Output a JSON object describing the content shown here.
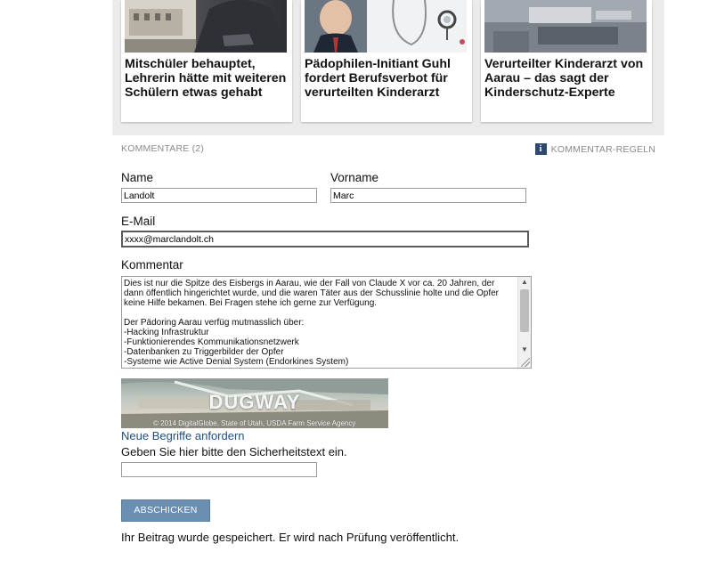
{
  "related_articles": [
    {
      "title": "Mitschüler behauptet, Lehrerin hätte mit weiteren Schülern etwas gehabt"
    },
    {
      "title": "Pädophilen-Initiant Guhl fordert Berufsverbot für verurteilten Kinderarzt"
    },
    {
      "title": "Verurteilter Kinderarzt von Aarau – das sagt der Kinderschutz-Experte"
    }
  ],
  "comments": {
    "count_label": "KOMMENTARE (2)",
    "rules_label": "KOMMENTAR-REGELN"
  },
  "form": {
    "name_label": "Name",
    "name_value": "Landolt",
    "vorname_label": "Vorname",
    "vorname_value": "Marc",
    "email_label": "E-Mail",
    "email_value": "xxxx@marclandolt.ch",
    "comment_label": "Kommentar",
    "comment_text": "Dies ist nur die Spitze des Eisbergs in Aarau, wie der Fall von Claude X vor ca. 20 Jahren, der\ndann öffentlich hingerichtet wurde, und die waren Täter aus der Schusslinie holte und die Opfer\nkeine Hilfe bekamen. Bei Fragen stehe ich gerne zur Verfügung.\n\nDer Pädoring Aarau verfüg mutmasslich über:\n-Hacking Infrastruktur\n-Funktionierendes Kommunikationsnetzwerk\n-Datenbanken zu Triggerbilder der Opfer\n-Systeme wie Active Denial System (Endorkines System)",
    "captcha_word": "DUGWAY",
    "captcha_credit": "© 2014 DigitalGlobe, State of Utah, USDA Farm Service Agency",
    "new_terms_link": "Neue Begriffe anfordern",
    "security_prompt": "Geben Sie hier bitte den Sicherheitstext ein.",
    "security_value": "",
    "submit_label": "ABSCHICKEN",
    "saved_message": "Ihr Beitrag wurde gespeichert. Er wird nach Prüfung veröffentlicht."
  }
}
